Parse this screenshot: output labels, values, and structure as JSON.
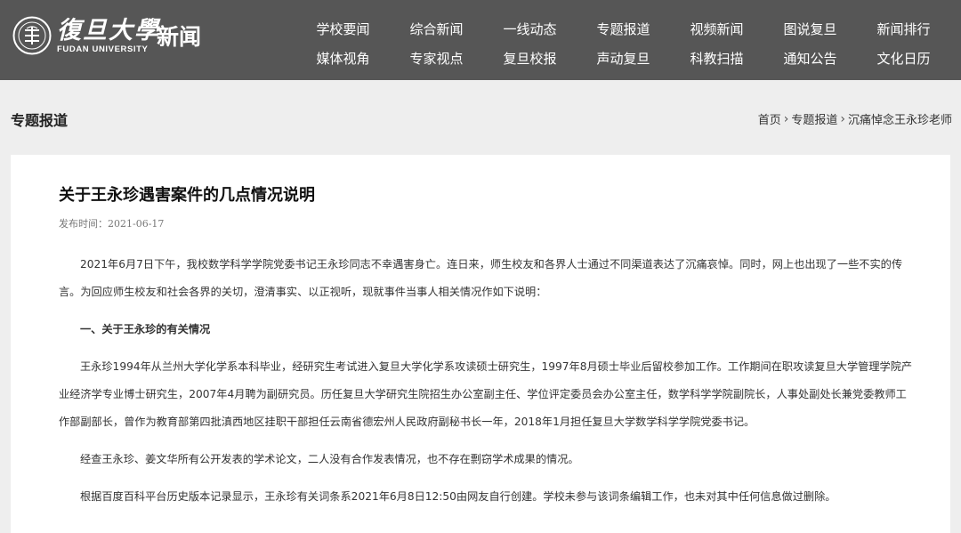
{
  "site": {
    "logo_cn": "復旦大學",
    "logo_en": "FUDAN UNIVERSITY",
    "section": "新闻"
  },
  "nav": {
    "row1": [
      "学校要闻",
      "综合新闻",
      "一线动态",
      "专题报道",
      "视频新闻",
      "图说复旦",
      "新闻排行"
    ],
    "row2": [
      "媒体视角",
      "专家视点",
      "复旦校报",
      "声动复旦",
      "科教扫描",
      "通知公告",
      "文化日历"
    ]
  },
  "subheader": {
    "title": "专题报道",
    "breadcrumb": [
      "首页",
      "专题报道",
      "沉痛悼念王永珍老师"
    ]
  },
  "article": {
    "title": "关于王永珍遇害案件的几点情况说明",
    "date_label": "发布时间：",
    "date": "2021-06-17",
    "paragraphs": [
      "2021年6月7日下午，我校数学科学学院党委书记王永珍同志不幸遇害身亡。连日来，师生校友和各界人士通过不同渠道表达了沉痛哀悼。同时，网上也出现了一些不实的传言。为回应师生校友和社会各界的关切，澄清事实、以正视听，现就事件当事人相关情况作如下说明：",
      "一、关于王永珍的有关情况",
      "王永珍1994年从兰州大学化学系本科毕业，经研究生考试进入复旦大学化学系攻读硕士研究生，1997年8月硕士毕业后留校参加工作。工作期间在职攻读复旦大学管理学院产业经济学专业博士研究生，2007年4月聘为副研究员。历任复旦大学研究生院招生办公室副主任、学位评定委员会办公室主任，数学科学学院副院长，人事处副处长兼党委教师工作部副部长，曾作为教育部第四批滇西地区挂职干部担任云南省德宏州人民政府副秘书长一年，2018年1月担任复旦大学数学科学学院党委书记。",
      "经查王永珍、姜文华所有公开发表的学术论文，二人没有合作发表情况，也不存在剽窃学术成果的情况。",
      "根据百度百科平台历史版本记录显示，王永珍有关词条系2021年6月8日12:50由网友自行创建。学校未参与该词条编辑工作，也未对其中任何信息做过删除。"
    ]
  }
}
